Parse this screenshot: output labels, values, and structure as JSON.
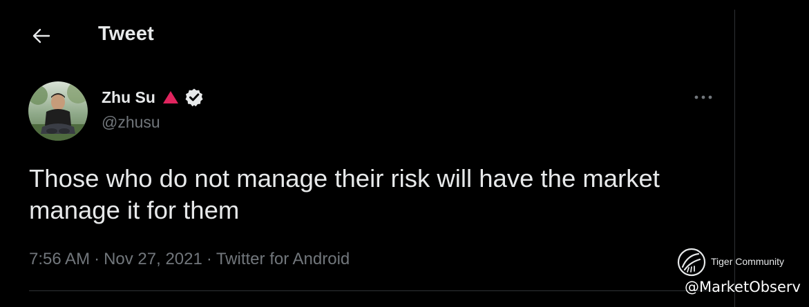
{
  "header": {
    "back_icon": "arrow-left-icon",
    "title": "Tweet"
  },
  "tweet": {
    "author": {
      "display_name": "Zhu Su",
      "handle": "@zhusu",
      "avatar_icon": "avatar-photo",
      "badge_triangle_icon": "red-triangle-icon",
      "verified_icon": "verified-badge-icon"
    },
    "more_icon": "more-horizontal-icon",
    "text": "Those who do not manage their risk will have the market manage it for them",
    "time": "7:56 AM",
    "separator": "·",
    "date": "Nov 27, 2021",
    "source": "Twitter for Android"
  },
  "watermark": {
    "logo_icon": "tiger-logo-icon",
    "brand": "Tiger Community",
    "handle": "@MarketObserv"
  },
  "colors": {
    "background": "#000000",
    "primary_text": "#e7e9ea",
    "secondary_text": "#71767b",
    "divider": "#2f3336",
    "triangle": "#e0245e"
  }
}
